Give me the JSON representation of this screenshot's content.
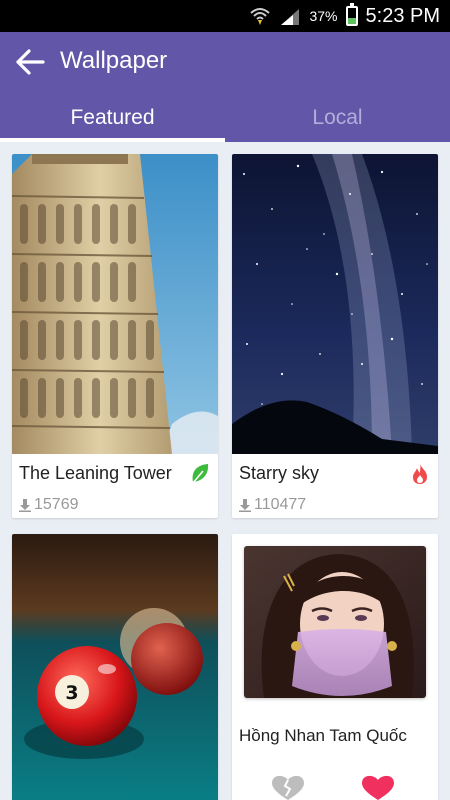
{
  "status_bar": {
    "battery_text": "37%",
    "battery_level": 0.37,
    "time": "5:23 PM"
  },
  "header": {
    "title": "Wallpaper"
  },
  "tabs": [
    {
      "label": "Featured",
      "active": true
    },
    {
      "label": "Local",
      "active": false
    }
  ],
  "wallpapers": [
    {
      "title": "The Leaning Tower",
      "downloads": "15769",
      "badge_icon": "leaf-icon",
      "badge_color": "#3dbb3d"
    },
    {
      "title": "Starry sky",
      "downloads": "110477",
      "badge_icon": "fire-icon",
      "badge_color": "#ef4b4b"
    },
    {
      "title": "",
      "downloads": "",
      "badge_icon": ""
    },
    {
      "title": "Hồng Nhan Tam Quốc"
    }
  ],
  "colors": {
    "accent": "#6256a8",
    "background": "#e9eef4"
  }
}
